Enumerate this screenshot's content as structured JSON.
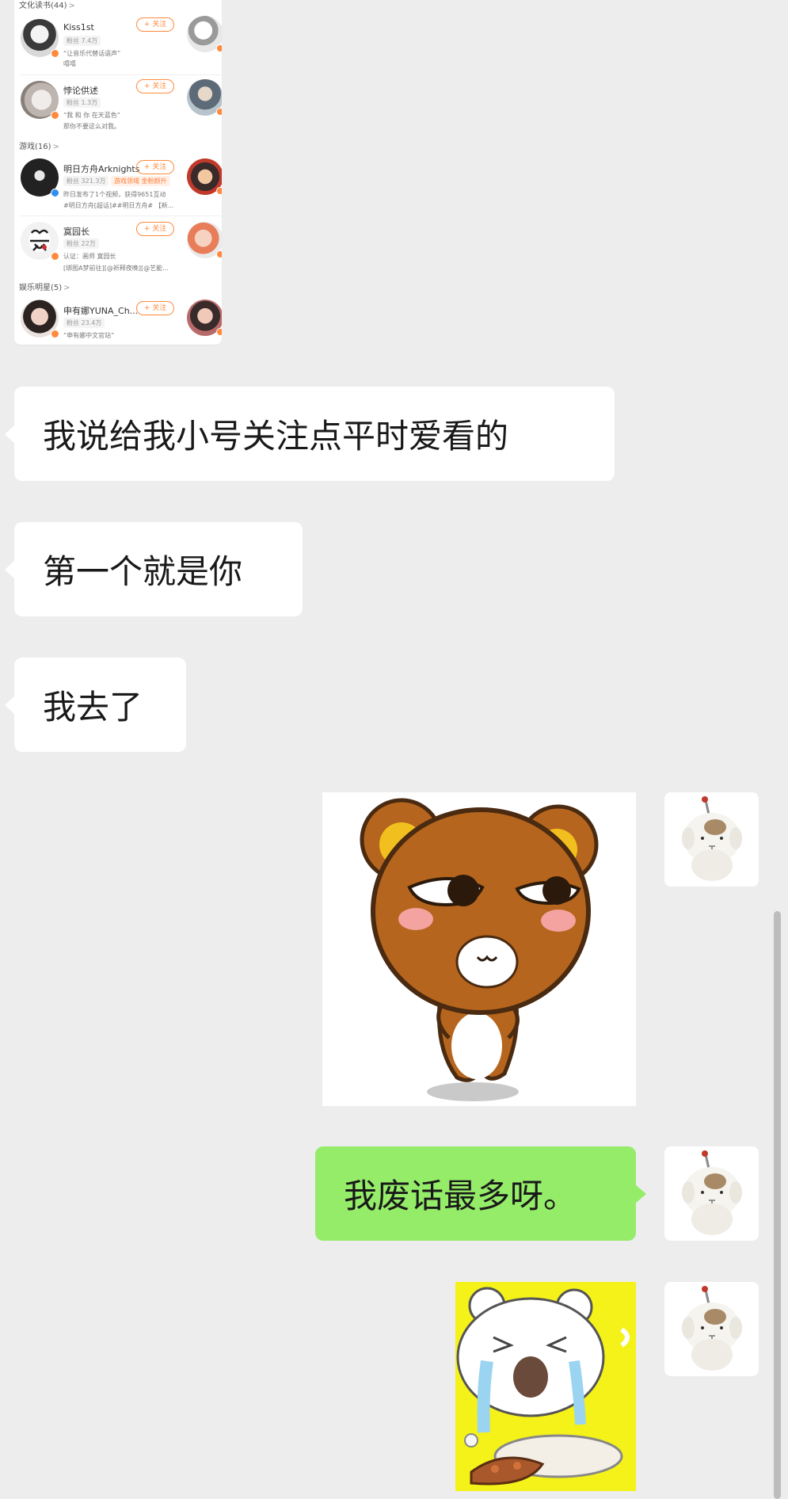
{
  "colors": {
    "background": "#ededed",
    "bubble_left": "#ffffff",
    "bubble_right": "#95ec69",
    "follow_accent": "#ff8a3d"
  },
  "shared_screenshot": {
    "sections": [
      {
        "label": "文化读书(44)",
        "chevron": ">"
      },
      {
        "label": "游戏(16)",
        "chevron": ">"
      },
      {
        "label": "娱乐明星(5)",
        "chevron": ">"
      }
    ],
    "follow_label": "+ 关注",
    "users": [
      {
        "name": "Kiss1st",
        "fans": "粉丝 7.4万",
        "desc1": "“让音乐代替话语声”",
        "desc2": "嘻嘻"
      },
      {
        "name": "悖论供述",
        "fans": "粉丝 1.3万",
        "desc1": "“我 和 你 在天蓝色”",
        "desc2": "那你不要这么对我。"
      },
      {
        "name": "明日方舟Arknights",
        "fans": "粉丝 321.3万",
        "tag": "游戏领域 金粉颜升",
        "desc1": "昨日发布了1个视频，获得9651互动",
        "desc2": "#明日方舟[超话]##明日方舟# 【新..."
      },
      {
        "name": "寞园长",
        "fans": "粉丝 22万",
        "desc1": "认证：画师 寞园长",
        "desc2": "[绑图A梦前往][@祈释夜晚][@艺能..."
      },
      {
        "name": "申有娜YUNA_Ch...",
        "fans": "粉丝 23.4万",
        "desc1": "“申有娜中文官站”",
        "desc2": ""
      }
    ]
  },
  "messages": [
    {
      "side": "left",
      "type": "text",
      "text": "我说给我小号关注点平时爱看的"
    },
    {
      "side": "left",
      "type": "text",
      "text": "第一个就是你"
    },
    {
      "side": "left",
      "type": "text",
      "text": "我去了"
    },
    {
      "side": "right",
      "type": "sticker",
      "sticker": "brown-bear-sticker"
    },
    {
      "side": "right",
      "type": "text",
      "text": "我废话最多呀。"
    },
    {
      "side": "right",
      "type": "sticker",
      "sticker": "crying-bear-sticker"
    }
  ]
}
